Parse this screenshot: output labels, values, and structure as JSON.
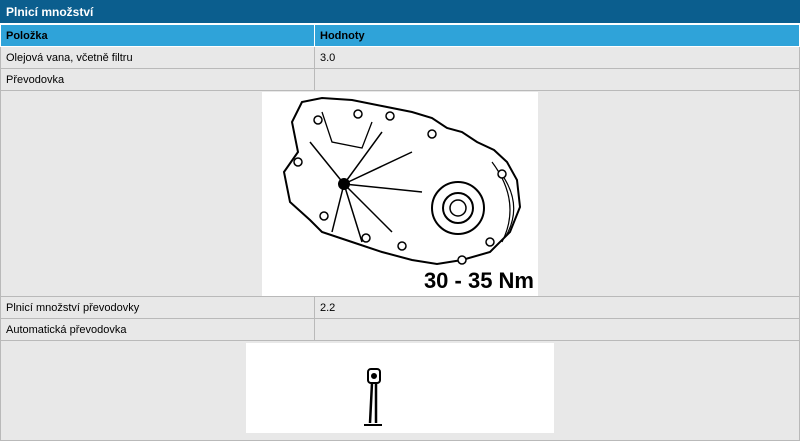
{
  "section": {
    "title": "Plnicí množství"
  },
  "table": {
    "headers": [
      "Položka",
      "Hodnoty"
    ],
    "rows": [
      {
        "item": "Olejová vana, včetně filtru",
        "value": "3.0"
      },
      {
        "item": "Převodovka",
        "value": ""
      },
      {
        "item": "Plnicí množství převodovky",
        "value": "2.2"
      },
      {
        "item": "Automatická převodovka",
        "value": ""
      }
    ]
  },
  "figure1": {
    "torque_label": "30 - 35 Nm"
  }
}
